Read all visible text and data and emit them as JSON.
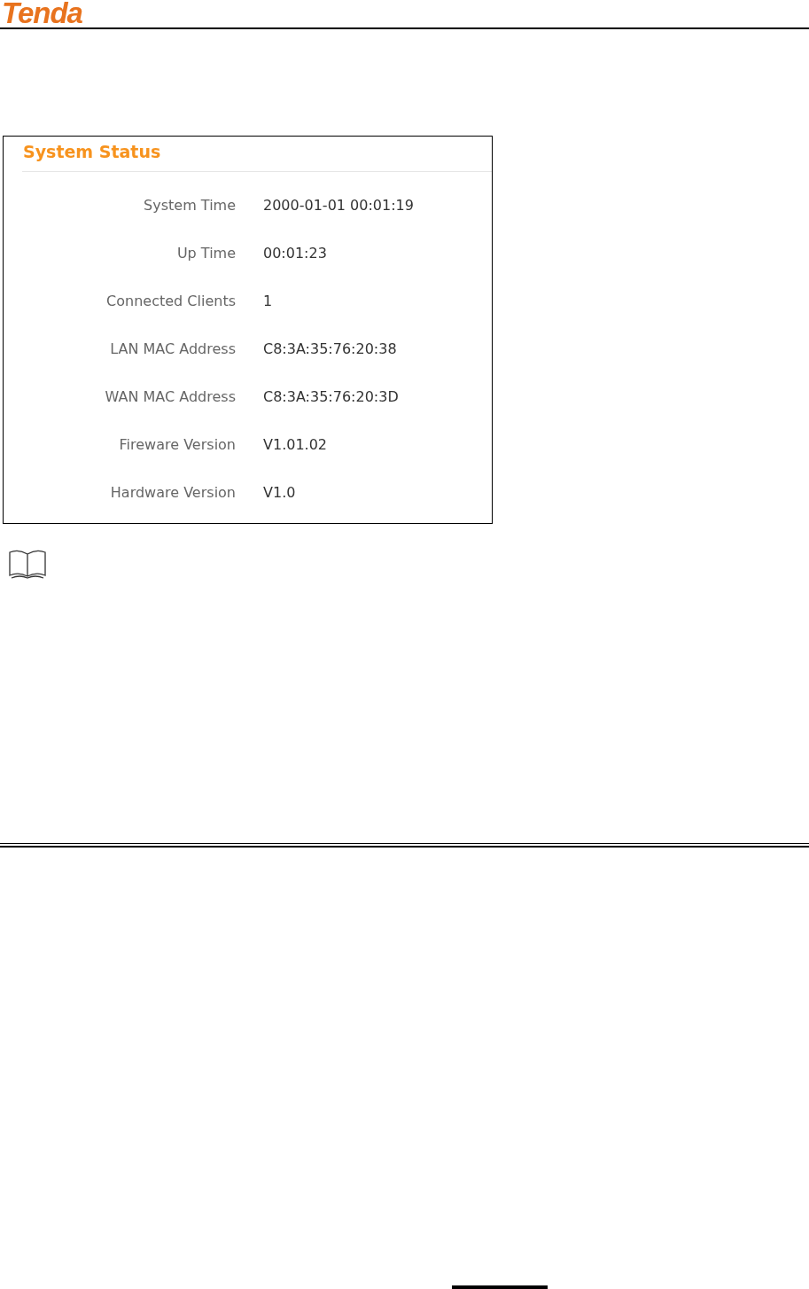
{
  "header": {
    "logo": "Tenda"
  },
  "panel": {
    "title": "System Status",
    "rows": [
      {
        "label": "System Time",
        "value": "2000-01-01 00:01:19"
      },
      {
        "label": "Up Time",
        "value": "00:01:23"
      },
      {
        "label": "Connected Clients",
        "value": "1"
      },
      {
        "label": "LAN MAC Address",
        "value": "C8:3A:35:76:20:38"
      },
      {
        "label": "WAN MAC Address",
        "value": "C8:3A:35:76:20:3D"
      },
      {
        "label": "Fireware Version",
        "value": "V1.01.02"
      },
      {
        "label": "Hardware Version",
        "value": "V1.0"
      }
    ]
  }
}
